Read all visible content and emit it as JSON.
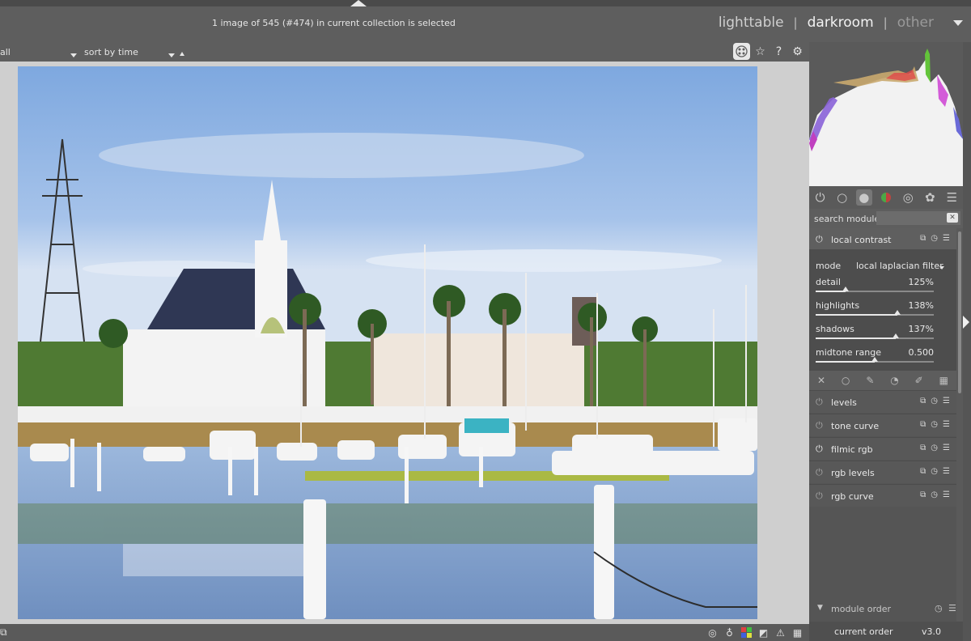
{
  "header": {
    "selection_info": "1 image of 545 (#474) in current collection is selected",
    "views": {
      "lighttable": "lighttable",
      "darkroom": "darkroom",
      "other": "other",
      "separator": "|"
    }
  },
  "filterbar": {
    "filter_value": "all",
    "sort_label": "sort by",
    "sort_value": "time"
  },
  "right_panel": {
    "search_label": "search module",
    "search_placeholder": "",
    "active_module": {
      "name": "local contrast",
      "mode_label": "mode",
      "mode_value": "local laplacian filter",
      "sliders": [
        {
          "label": "detail",
          "value": "125%",
          "level": 0.25
        },
        {
          "label": "highlights",
          "value": "138%",
          "level": 0.69
        },
        {
          "label": "shadows",
          "value": "137%",
          "level": 0.68
        },
        {
          "label": "midtone range",
          "value": "0.500",
          "level": 0.5
        }
      ]
    },
    "modules": [
      {
        "name": "levels",
        "enabled": false
      },
      {
        "name": "tone curve",
        "enabled": false
      },
      {
        "name": "filmic rgb",
        "enabled": true
      },
      {
        "name": "rgb levels",
        "enabled": false
      },
      {
        "name": "rgb curve",
        "enabled": false
      }
    ],
    "module_order_label": "module order",
    "current_order_label": "current order",
    "current_order_value": "v3.0"
  },
  "colors": {
    "accent": "#e8e8e8",
    "panel_bg": "#555555",
    "center_bg": "#cfcfcf"
  }
}
